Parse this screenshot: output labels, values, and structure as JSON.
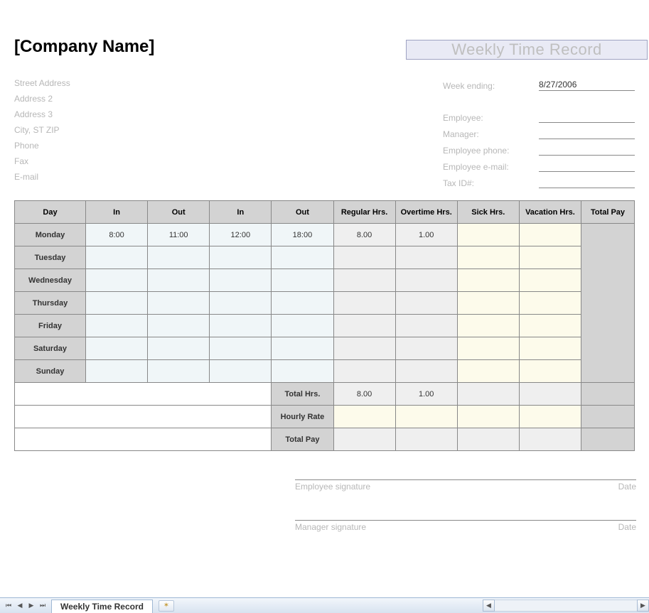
{
  "header": {
    "doc_title": "Weekly Time Record",
    "company_name": "[Company Name]"
  },
  "address": {
    "street": "Street Address",
    "addr2": "Address 2",
    "addr3": "Address 3",
    "citystzip": "City, ST  ZIP",
    "phone": "Phone",
    "fax": "Fax",
    "email": "E-mail"
  },
  "details": {
    "week_ending_label": "Week ending:",
    "week_ending_value": "8/27/2006",
    "employee_label": "Employee:",
    "employee_value": "",
    "manager_label": "Manager:",
    "manager_value": "",
    "emp_phone_label": "Employee phone:",
    "emp_phone_value": "",
    "emp_email_label": "Employee e-mail:",
    "emp_email_value": "",
    "tax_label": "Tax ID#:",
    "tax_value": ""
  },
  "table": {
    "headers": {
      "day": "Day",
      "in1": "In",
      "out1": "Out",
      "in2": "In",
      "out2": "Out",
      "reg": "Regular Hrs.",
      "ot": "Overtime Hrs.",
      "sick": "Sick Hrs.",
      "vac": "Vacation Hrs.",
      "total": "Total Pay"
    },
    "rows": [
      {
        "day": "Monday",
        "in1": "8:00",
        "out1": "11:00",
        "in2": "12:00",
        "out2": "18:00",
        "reg": "8.00",
        "ot": "1.00"
      },
      {
        "day": "Tuesday"
      },
      {
        "day": "Wednesday"
      },
      {
        "day": "Thursday"
      },
      {
        "day": "Friday"
      },
      {
        "day": "Saturday"
      },
      {
        "day": "Sunday"
      }
    ],
    "summary": {
      "total_hrs_label": "Total Hrs.",
      "total_reg": "8.00",
      "total_ot": "1.00",
      "hourly_rate_label": "Hourly Rate",
      "total_pay_label": "Total Pay"
    }
  },
  "signatures": {
    "employee": "Employee signature",
    "manager": "Manager signature",
    "date": "Date"
  },
  "statusbar": {
    "tab_name": "Weekly Time Record"
  }
}
